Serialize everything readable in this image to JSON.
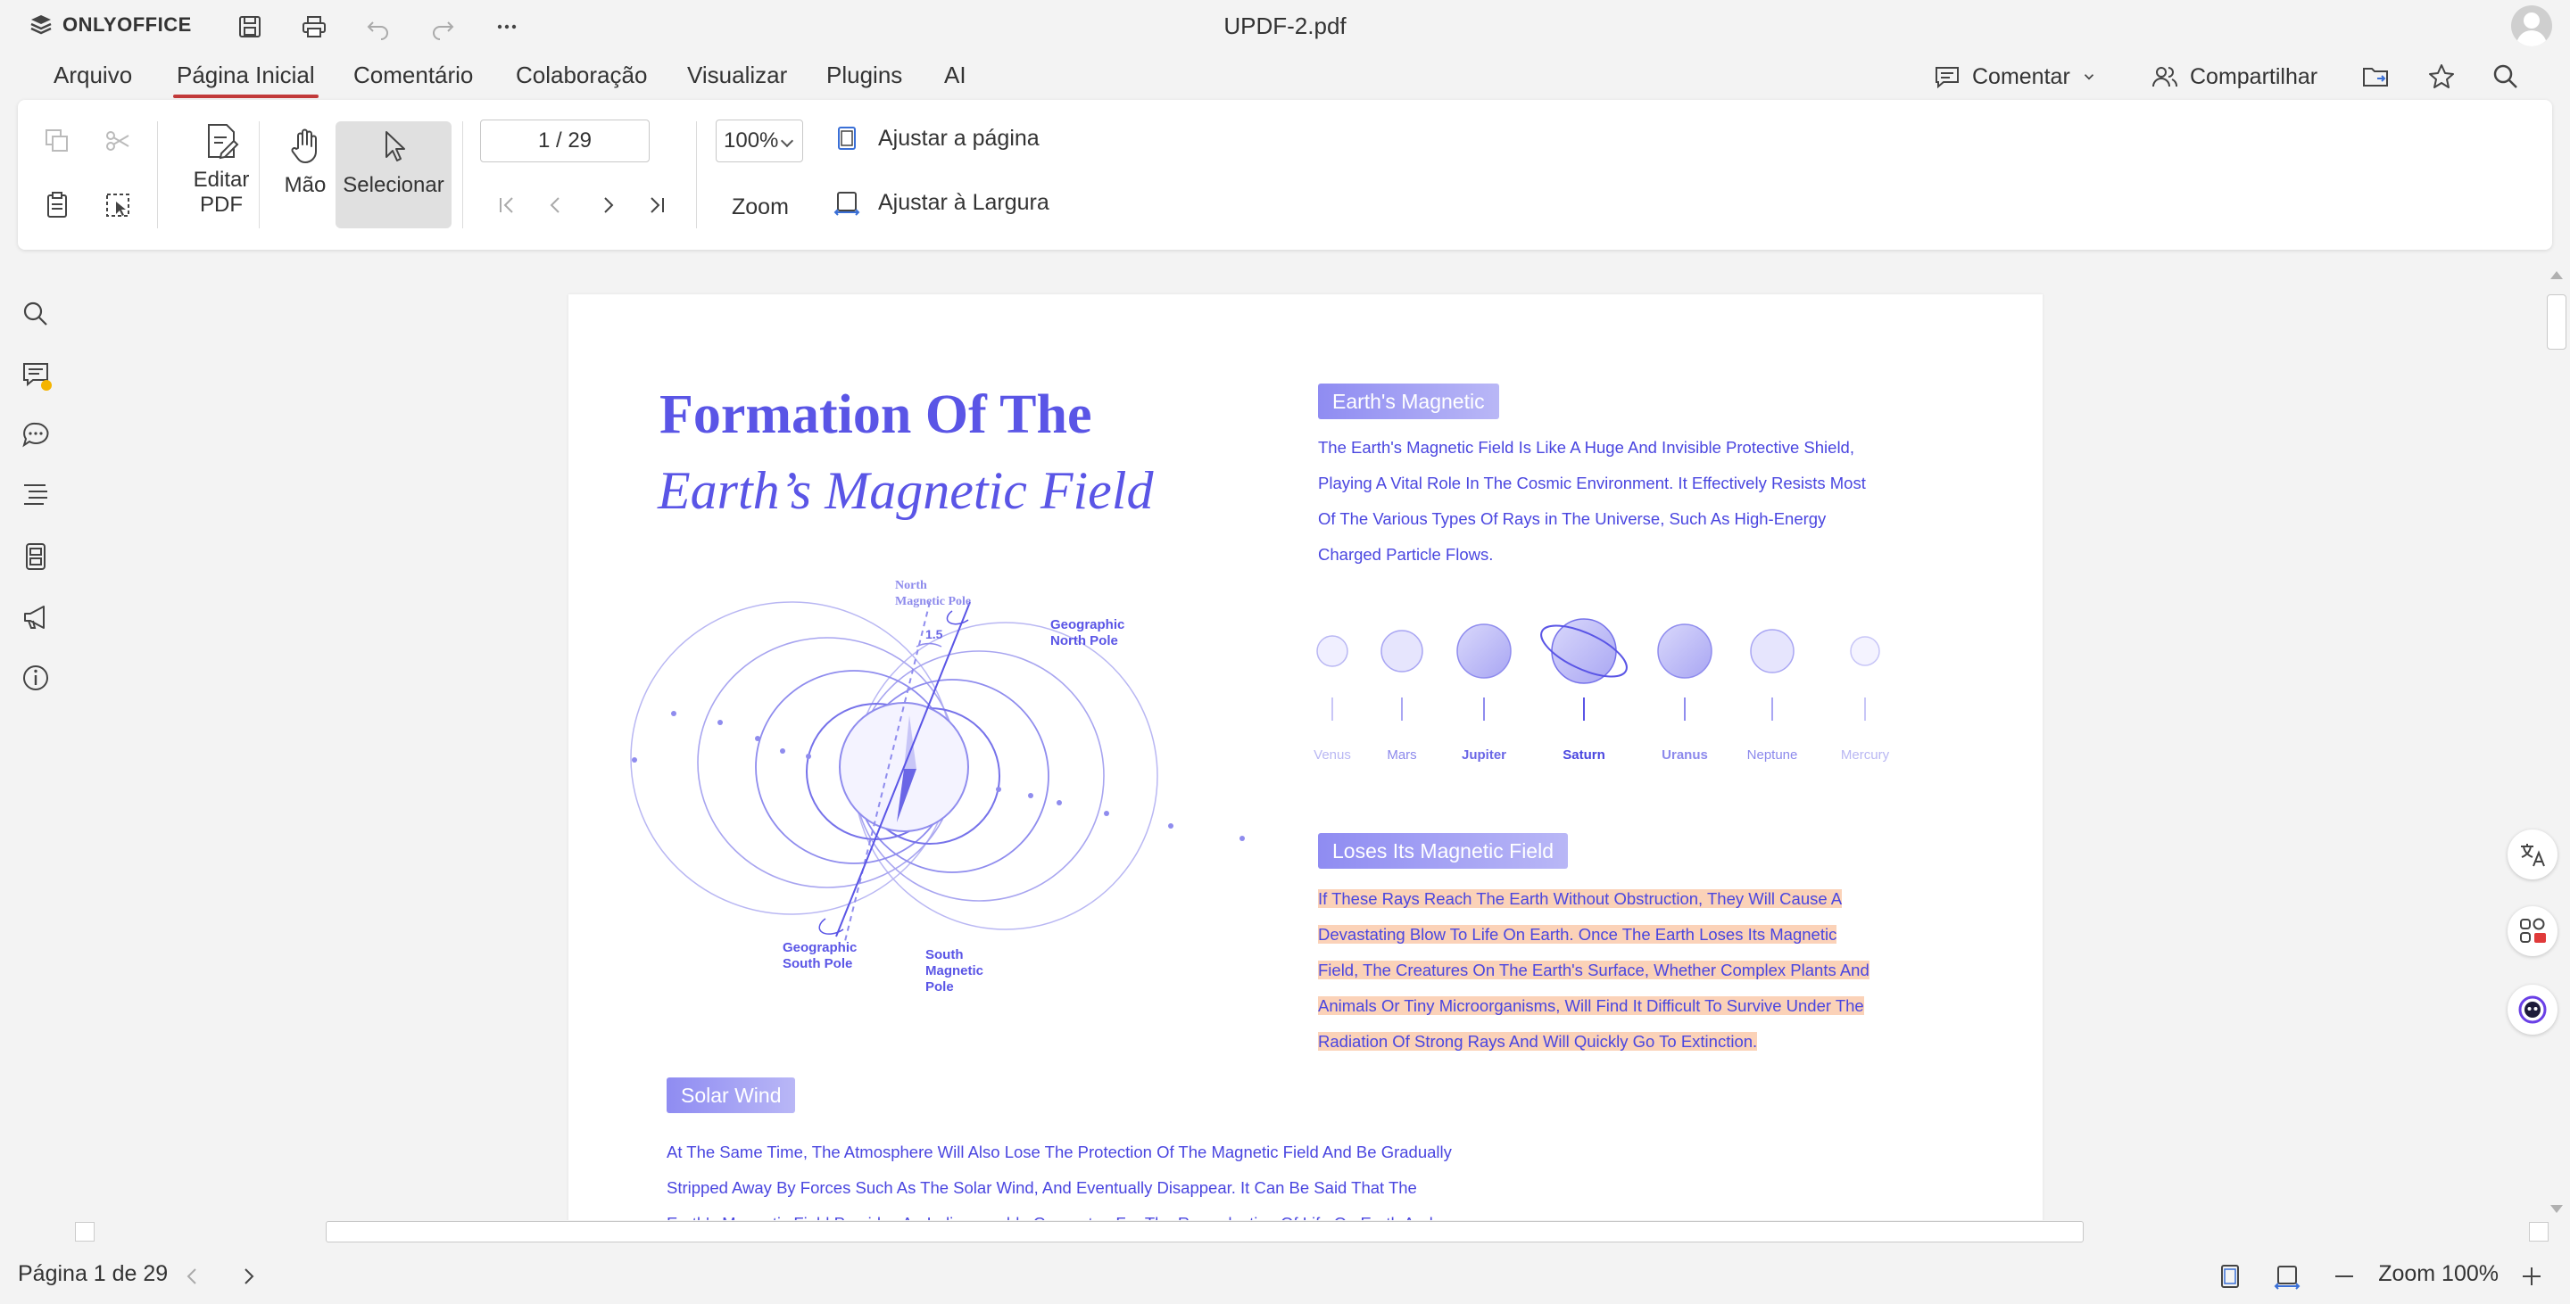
{
  "app": {
    "brand": "ONLYOFFICE",
    "document_title": "UPDF-2.pdf"
  },
  "menu": {
    "tabs": [
      {
        "label": "Arquivo"
      },
      {
        "label": "Página Inicial"
      },
      {
        "label": "Comentário"
      },
      {
        "label": "Colaboração"
      },
      {
        "label": "Visualizar"
      },
      {
        "label": "Plugins"
      },
      {
        "label": "AI"
      }
    ],
    "active_tab": "Página Inicial",
    "comment_label": "Comentar",
    "share_label": "Compartilhar"
  },
  "toolbar": {
    "edit_pdf_line1": "Editar",
    "edit_pdf_line2": "PDF",
    "hand_label": "Mão",
    "select_label": "Selecionar",
    "page_value": "1 / 29",
    "zoom_value": "100%",
    "zoom_label": "Zoom",
    "fit_page_label": "Ajustar a página",
    "fit_width_label": "Ajustar à Largura"
  },
  "document": {
    "title_line1": "Formation Of The",
    "title_line2": "Earth’s Magnetic Field",
    "section1_heading": "Earth's Magnetic",
    "section1_lines": [
      "The Earth's Magnetic Field Is Like A Huge And Invisible Protective Shield,",
      "Playing A Vital Role In The Cosmic Environment. It Effectively Resists Most",
      "Of The Various Types Of Rays in The Universe, Such As High-Energy",
      "Charged Particle Flows."
    ],
    "planets": [
      "Venus",
      "Mars",
      "Jupiter",
      "Saturn",
      "Uranus",
      "Neptune",
      "Mercury"
    ],
    "diagram_labels": {
      "north_magnetic_line1": "North",
      "north_magnetic_line2": "Magnetic Pole",
      "geo_north_line1": "Geographic",
      "geo_north_line2": "North Pole",
      "angle": "1.5",
      "geo_south_line1": "Geographic",
      "geo_south_line2": "South Pole",
      "south_magnetic_line1": "South",
      "south_magnetic_line2": "Magnetic",
      "south_magnetic_line3": "Pole"
    },
    "section2_heading": "Loses Its Magnetic Field",
    "section2_lines": [
      "If These Rays Reach The Earth Without Obstruction, They Will Cause A",
      "Devastating Blow To Life On Earth. Once The Earth Loses Its Magnetic",
      "Field, The Creatures On The Earth's Surface, Whether Complex Plants And",
      "Animals Or Tiny Microorganisms, Will Find It Difficult To Survive Under The",
      "Radiation Of Strong Rays And Will Quickly Go To Extinction."
    ],
    "section3_heading": "Solar Wind",
    "section3_lines": [
      "At The Same Time, The Atmosphere Will Also Lose The Protection Of The Magnetic Field And Be Gradually",
      "Stripped Away By Forces Such As The Solar Wind, And Eventually Disappear. It Can Be Said That The",
      "Earth's Magnetic Field Provides An Indispensable Guarantee For The Reproduction Of Life On Earth And"
    ]
  },
  "status": {
    "page_status": "Página 1 de 29",
    "zoom_status": "Zoom 100%"
  },
  "colors": {
    "accent_red": "#c23a3a",
    "doc_blue": "#4a46e0",
    "highlight": "#fbd2b8"
  }
}
